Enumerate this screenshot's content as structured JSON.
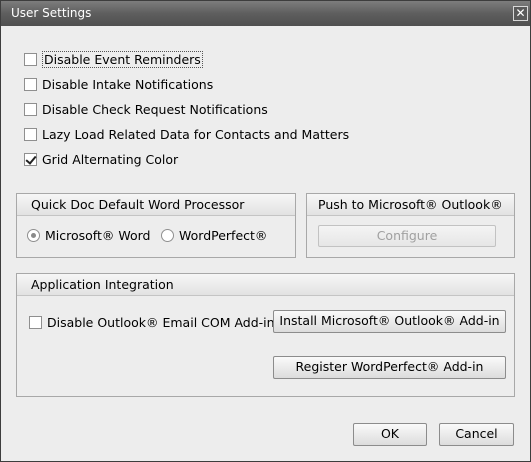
{
  "window": {
    "title": "User Settings",
    "close_glyph": "✕"
  },
  "options": [
    {
      "label": "Disable Event Reminders",
      "checked": false
    },
    {
      "label": "Disable Intake Notifications",
      "checked": false
    },
    {
      "label": "Disable Check Request Notifications",
      "checked": false
    },
    {
      "label": "Lazy Load Related Data for Contacts and Matters",
      "checked": false
    },
    {
      "label": "Grid Alternating Color",
      "checked": true
    }
  ],
  "word_processor": {
    "title": "Quick Doc Default Word Processor",
    "options": [
      {
        "label": "Microsoft® Word",
        "selected": true
      },
      {
        "label": "WordPerfect®",
        "selected": false
      }
    ]
  },
  "outlook_push": {
    "title": "Push to Microsoft® Outlook®",
    "configure_label": "Configure"
  },
  "integration": {
    "title": "Application Integration",
    "disable_com_label": "Disable Outlook® Email COM Add-in",
    "install_outlook_label": "Install Microsoft® Outlook® Add-in",
    "register_wp_label": "Register WordPerfect® Add-in"
  },
  "footer": {
    "ok_label": "OK",
    "cancel_label": "Cancel"
  }
}
